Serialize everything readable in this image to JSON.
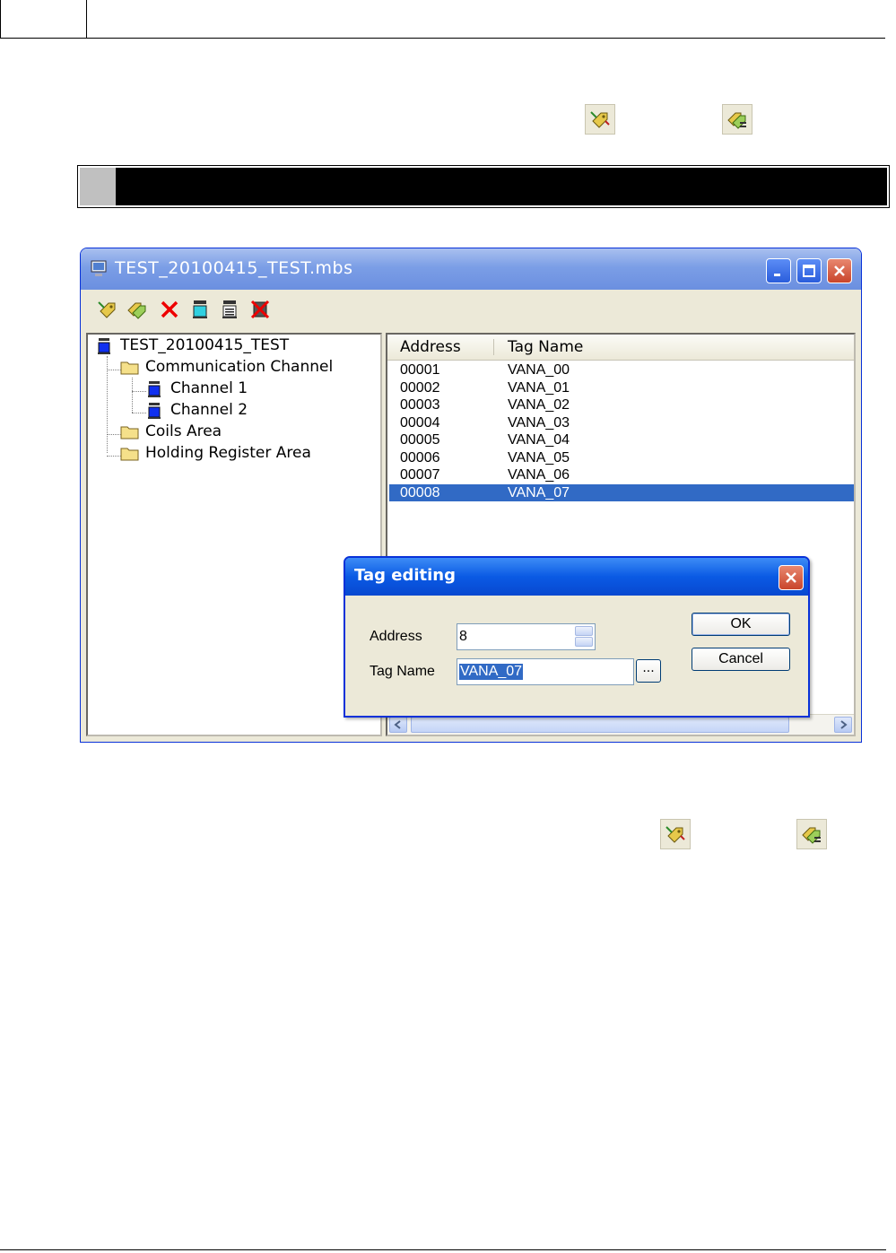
{
  "window": {
    "title": "TEST_20100415_TEST.mbs"
  },
  "toolbar": {
    "tools": [
      "add-tag-icon",
      "edit-tag-icon",
      "delete-icon",
      "channel-icon",
      "register-icon",
      "delete-area-icon"
    ]
  },
  "tree": {
    "root": "TEST_20100415_TEST",
    "items": [
      {
        "label": "Communication Channel",
        "level": 1
      },
      {
        "label": "Channel 1",
        "level": 2
      },
      {
        "label": "Channel 2",
        "level": 2
      },
      {
        "label": "Coils Area",
        "level": 1
      },
      {
        "label": "Holding Register Area",
        "level": 1
      }
    ]
  },
  "list": {
    "columns": [
      "Address",
      "Tag Name"
    ],
    "rows": [
      {
        "address": "00001",
        "tag": "VANA_00"
      },
      {
        "address": "00002",
        "tag": "VANA_01"
      },
      {
        "address": "00003",
        "tag": "VANA_02"
      },
      {
        "address": "00004",
        "tag": "VANA_03"
      },
      {
        "address": "00005",
        "tag": "VANA_04"
      },
      {
        "address": "00006",
        "tag": "VANA_05"
      },
      {
        "address": "00007",
        "tag": "VANA_06"
      },
      {
        "address": "00008",
        "tag": "VANA_07"
      }
    ],
    "selected_index": 7
  },
  "dialog": {
    "title": "Tag editing",
    "address_label": "Address",
    "address_value": "8",
    "tagname_label": "Tag Name",
    "tagname_value": "VANA_07",
    "browse_label": "...",
    "ok_label": "OK",
    "cancel_label": "Cancel"
  },
  "colors": {
    "selection": "#316ac5",
    "titlebar": "#7b9ee6",
    "dialog_titlebar": "#0a5ae4"
  }
}
